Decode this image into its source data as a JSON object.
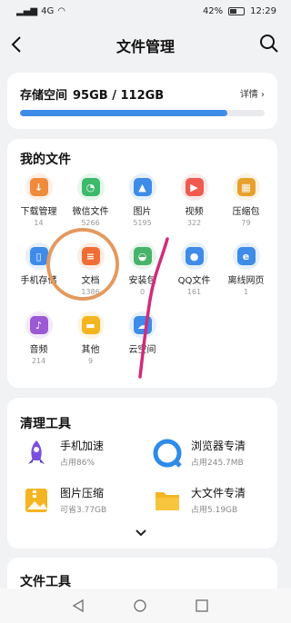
{
  "status": {
    "signal": "4G",
    "battery": "42%",
    "time": "12:29"
  },
  "header": {
    "title": "文件管理"
  },
  "storage": {
    "label": "存储空间",
    "used": "95GB / 112GB",
    "detail": "详情",
    "used_fraction": 0.848
  },
  "my_files": {
    "title": "我的文件",
    "items": [
      {
        "name": "下载管理",
        "count": "14",
        "icon": "download-icon",
        "color": "#f08a3c"
      },
      {
        "name": "微信文件",
        "count": "5266",
        "icon": "wechat-icon",
        "color": "#3cb96a"
      },
      {
        "name": "图片",
        "count": "5195",
        "icon": "image-icon",
        "color": "#3f8be8"
      },
      {
        "name": "视频",
        "count": "322",
        "icon": "video-icon",
        "color": "#f05a4f"
      },
      {
        "name": "压缩包",
        "count": "79",
        "icon": "archive-icon",
        "color": "#e7a02c"
      },
      {
        "name": "手机存储",
        "count": "",
        "icon": "phone-icon",
        "color": "#3f8be8"
      },
      {
        "name": "文档",
        "count": "1386",
        "icon": "document-icon",
        "color": "#f06e35"
      },
      {
        "name": "安装包",
        "count": "0",
        "icon": "android-icon",
        "color": "#48b36a"
      },
      {
        "name": "QQ文件",
        "count": "161",
        "icon": "qq-icon",
        "color": "#3f8be8"
      },
      {
        "name": "离线网页",
        "count": "1",
        "icon": "webpage-icon",
        "color": "#3f8be8"
      },
      {
        "name": "音频",
        "count": "214",
        "icon": "music-icon",
        "color": "#9b59d6"
      },
      {
        "name": "其他",
        "count": "9",
        "icon": "folder-icon",
        "color": "#f5b521"
      },
      {
        "name": "云空间",
        "count": "",
        "icon": "cloud-icon",
        "color": "#3f8be8"
      }
    ]
  },
  "clean_tools": {
    "title": "清理工具",
    "items": [
      {
        "name": "手机加速",
        "sub": "占用86%",
        "icon": "rocket-icon"
      },
      {
        "name": "浏览器专清",
        "sub": "占用245.7MB",
        "icon": "browser-icon"
      },
      {
        "name": "图片压缩",
        "sub": "可省3.77GB",
        "icon": "image-compress-icon"
      },
      {
        "name": "大文件专清",
        "sub": "占用5.19GB",
        "icon": "big-file-icon"
      }
    ]
  },
  "file_tools": {
    "title": "文件工具"
  }
}
